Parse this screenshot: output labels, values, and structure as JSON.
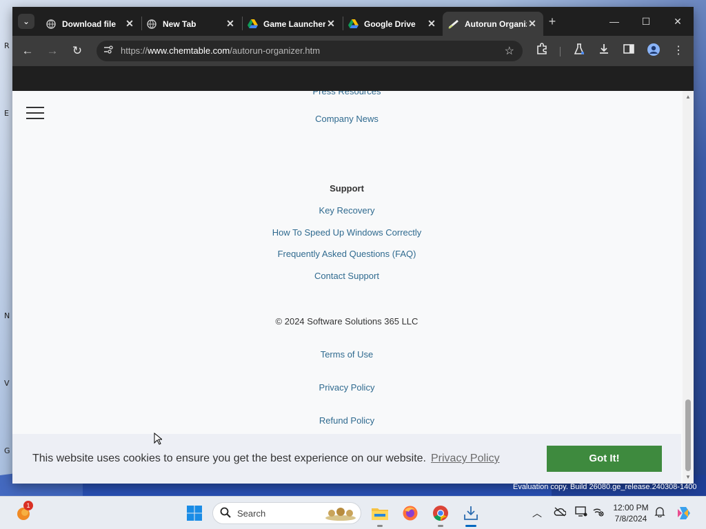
{
  "browser": {
    "tabs": [
      {
        "label": "Download file",
        "icon": "globe-icon"
      },
      {
        "label": "New Tab",
        "icon": "globe-icon"
      },
      {
        "label": "Game Launcher",
        "icon": "google-drive-icon"
      },
      {
        "label": "Google Drive",
        "icon": "google-drive-icon"
      },
      {
        "label": "Autorun Organizer",
        "icon": "chemtable-icon",
        "active": true
      }
    ],
    "url_prefix": "https://",
    "url_host": "www.chemtable.com",
    "url_path": "/autorun-organizer.htm"
  },
  "page": {
    "partial_link": "Press Resources",
    "company_news": "Company News",
    "support_heading": "Support",
    "support_links": [
      "Key Recovery",
      "How To Speed Up Windows Correctly",
      "Frequently Asked Questions (FAQ)",
      "Contact Support"
    ],
    "copyright": "© 2024 Software Solutions 365 LLC",
    "legal_links": [
      "Terms of Use",
      "Privacy Policy",
      "Refund Policy"
    ]
  },
  "cookie_banner": {
    "message": "This website uses cookies to ensure you get the best experience on our website.",
    "link": "Privacy Policy",
    "button": "Got It!"
  },
  "watermark": "Evaluation copy. Build 26080.ge_release.240308-1400",
  "taskbar": {
    "search_placeholder": "Search",
    "notification_count": "1",
    "time": "12:00 PM",
    "date": "7/8/2024"
  },
  "colors": {
    "link": "#2f6a8f",
    "cookie_button": "#3e8a3e",
    "browser_frame": "#1f1f1f"
  }
}
